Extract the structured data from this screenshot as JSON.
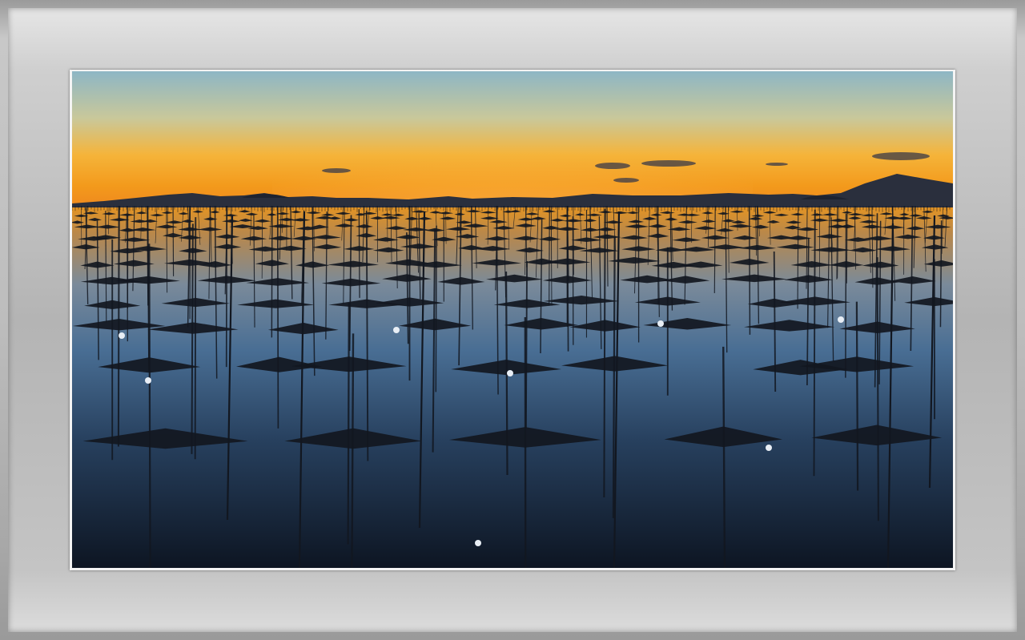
{
  "scene": {
    "subject": "seaweed-farm-poles-at-sunset",
    "sky_top": "#8fb6c4",
    "sky_glow": "#f7a21a",
    "horizon": "#f08a1c",
    "water_top": "#c98a3a",
    "water_mid": "#3c5f86",
    "water_bottom": "#0f1826",
    "silhouette": "#121720",
    "buoy": "#e8eef5"
  }
}
